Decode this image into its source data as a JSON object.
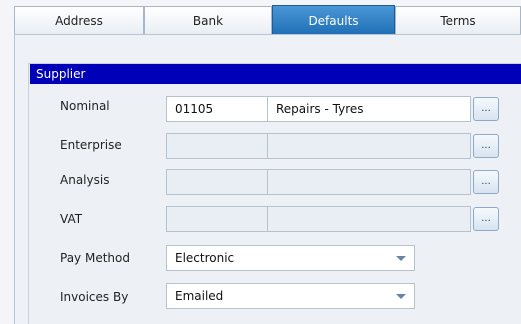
{
  "tabs": [
    {
      "label": "Address"
    },
    {
      "label": "Bank"
    },
    {
      "label": "Defaults"
    },
    {
      "label": "Terms"
    }
  ],
  "group": {
    "title": "Supplier"
  },
  "rows": {
    "nominal": {
      "label": "Nominal",
      "code": "01105",
      "description": "Repairs - Tyres",
      "button": "..."
    },
    "enterprise": {
      "label": "Enterprise",
      "code": "",
      "description": "",
      "button": "..."
    },
    "analysis": {
      "label": "Analysis",
      "code": "",
      "description": "",
      "button": "..."
    },
    "vat": {
      "label": "VAT",
      "code": "",
      "description": "",
      "button": "..."
    }
  },
  "pay_method": {
    "label": "Pay Method",
    "value": "Electronic"
  },
  "invoices_by": {
    "label": "Invoices By",
    "value": "Emailed"
  }
}
